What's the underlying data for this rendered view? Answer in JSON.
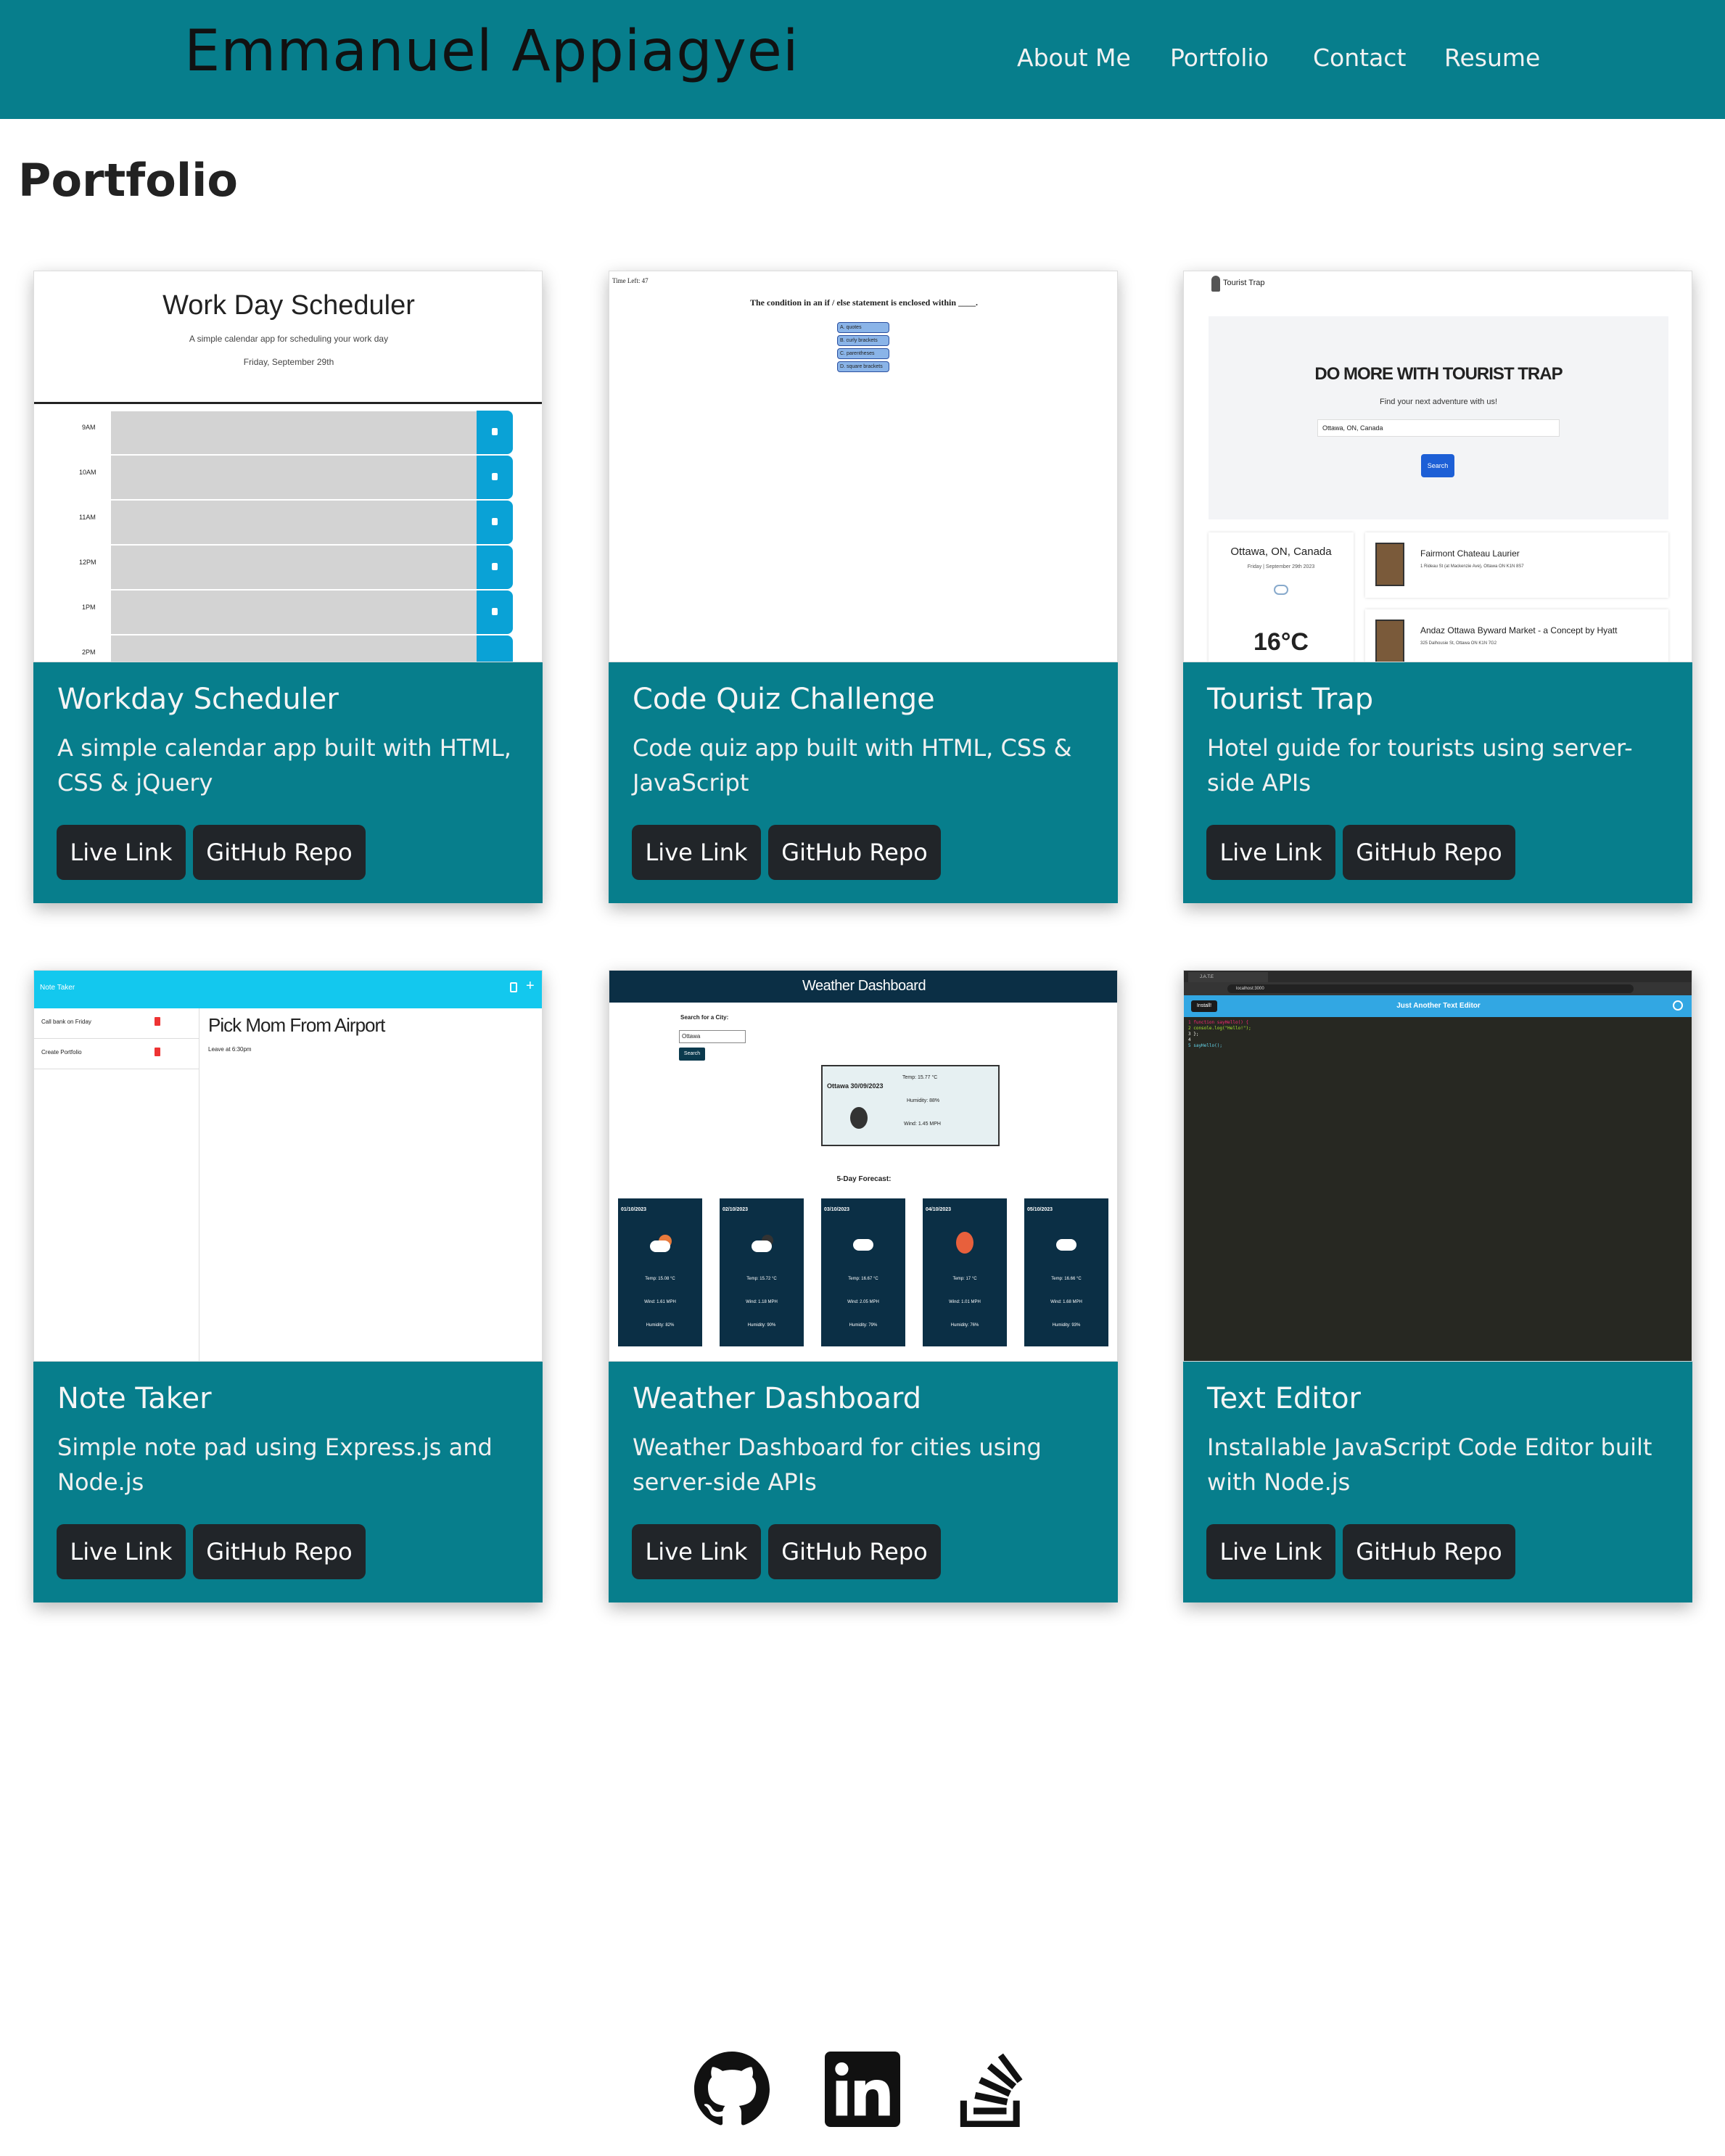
{
  "header": {
    "brand": "Emmanuel Appiagyei",
    "nav": [
      "About Me",
      "Portfolio",
      "Contact",
      "Resume"
    ]
  },
  "page_title": "Portfolio",
  "projects": [
    {
      "title": "Workday Scheduler",
      "description": "A simple calendar app built with HTML, CSS & jQuery",
      "live_label": "Live Link",
      "repo_label": "GitHub Repo",
      "preview": {
        "heading": "Work Day Scheduler",
        "subheading": "A simple calendar app for scheduling your work day",
        "date": "Friday, September 29th",
        "hours": [
          "9AM",
          "10AM",
          "11AM",
          "12PM",
          "1PM",
          "2PM"
        ]
      }
    },
    {
      "title": "Code Quiz Challenge",
      "description": "Code quiz app built with HTML, CSS & JavaScript",
      "live_label": "Live Link",
      "repo_label": "GitHub Repo",
      "preview": {
        "timer": "Time Left: 47",
        "question": "The condition in an if / else statement is enclosed within ____.",
        "answers": [
          "A. quotes",
          "B. curly brackets",
          "C. parentheses",
          "D. square brackets"
        ]
      }
    },
    {
      "title": "Tourist Trap",
      "description": "Hotel guide for tourists using server-side APIs",
      "live_label": "Live Link",
      "repo_label": "GitHub Repo",
      "preview": {
        "logo": "Tourist Trap",
        "hero": "DO MORE WITH TOURIST TRAP",
        "tagline": "Find your next adventure with us!",
        "search_value": "Ottawa, ON, Canada",
        "search_button": "Search",
        "city": "Ottawa, ON, Canada",
        "date": "Friday | September 29th 2023",
        "temp": "16°C",
        "hotels": [
          {
            "name": "Fairmont Chateau Laurier",
            "address": "1 Rideau St (at Mackenzie Ave), Ottawa ON K1N 8S7"
          },
          {
            "name": "Andaz Ottawa Byward Market - a Concept by Hyatt",
            "address": "325 Dalhousie St, Ottawa ON K1N 7G2"
          }
        ]
      }
    },
    {
      "title": "Note Taker",
      "description": "Simple note pad using Express.js and Node.js",
      "live_label": "Live Link",
      "repo_label": "GitHub Repo",
      "preview": {
        "app_title": "Note Taker",
        "notes": [
          "Call bank on Friday",
          "Create Portfolio"
        ],
        "note_title": "Pick Mom From Airport",
        "note_text": "Leave at 6:30pm"
      }
    },
    {
      "title": "Weather Dashboard",
      "description": "Weather Dashboard for cities using server-side APIs",
      "live_label": "Live Link",
      "repo_label": "GitHub Repo",
      "preview": {
        "app_title": "Weather Dashboard",
        "search_label": "Search for a City:",
        "search_value": "Ottawa",
        "search_button": "Search",
        "current": {
          "city": "Ottawa 30/09/2023",
          "temp": "Temp: 15.77 °C",
          "humidity": "Humidity: 88%",
          "wind": "Wind: 1.45 MPH"
        },
        "forecast_label": "5-Day Forecast:",
        "forecast": [
          {
            "date": "01/10/2023",
            "temp": "Temp: 15.08 °C",
            "wind": "Wind: 1.61 MPH",
            "humidity": "Humidity: 82%"
          },
          {
            "date": "02/10/2023",
            "temp": "Temp: 15.72 °C",
            "wind": "Wind: 1.18 MPH",
            "humidity": "Humidity: 90%"
          },
          {
            "date": "03/10/2023",
            "temp": "Temp: 16.67 °C",
            "wind": "Wind: 2.05 MPH",
            "humidity": "Humidity: 79%"
          },
          {
            "date": "04/10/2023",
            "temp": "Temp: 17 °C",
            "wind": "Wind: 1.01 MPH",
            "humidity": "Humidity: 76%"
          },
          {
            "date": "05/10/2023",
            "temp": "Temp: 16.66 °C",
            "wind": "Wind: 1.68 MPH",
            "humidity": "Humidity: 93%"
          }
        ]
      }
    },
    {
      "title": "Text Editor",
      "description": "Installable JavaScript Code Editor built with Node.js",
      "live_label": "Live Link",
      "repo_label": "GitHub Repo",
      "preview": {
        "tab": "J.A.T.E",
        "url": "localhost:3000",
        "install_button": "Install!",
        "app_title": "Just Another Text Editor",
        "code": [
          "1 function sayHello() {",
          "2   console.log(\"Hello!\");",
          "3 };",
          "4",
          "5 sayHello();"
        ]
      }
    }
  ],
  "footer": {
    "icons": [
      "github-icon",
      "linkedin-icon",
      "stackoverflow-icon"
    ]
  },
  "colors": {
    "primary": "#077e8c",
    "button": "#212529",
    "accent_blue": "#0aa2d6"
  }
}
